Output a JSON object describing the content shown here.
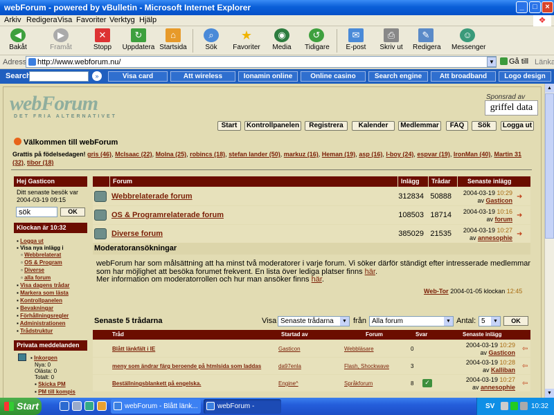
{
  "window": {
    "title": "webForum - powered by vBulletin - Microsoft Internet Explorer"
  },
  "menu": [
    "Arkiv",
    "Redigera",
    "Visa",
    "Favoriter",
    "Verktyg",
    "Hjälp"
  ],
  "toolbar": [
    {
      "label": "Bakåt",
      "icon": "back-icon"
    },
    {
      "label": "Framåt",
      "icon": "forward-icon"
    },
    {
      "label": "Stopp",
      "icon": "stop-icon"
    },
    {
      "label": "Uppdatera",
      "icon": "refresh-icon"
    },
    {
      "label": "Startsida",
      "icon": "home-icon"
    },
    {
      "label": "Sök",
      "icon": "search-icon"
    },
    {
      "label": "Favoriter",
      "icon": "star-icon"
    },
    {
      "label": "Media",
      "icon": "media-icon"
    },
    {
      "label": "Tidigare",
      "icon": "history-icon"
    },
    {
      "label": "E-post",
      "icon": "mail-icon"
    },
    {
      "label": "Skriv ut",
      "icon": "print-icon"
    },
    {
      "label": "Redigera",
      "icon": "edit-icon"
    },
    {
      "label": "Messenger",
      "icon": "messenger-icon"
    }
  ],
  "address": {
    "label": "Adress",
    "url": "http://www.webforum.nu/",
    "go": "Gå till",
    "links": "Länkar"
  },
  "search_toolbar": {
    "label": "Search",
    "links": [
      "Visa card",
      "Att wireless",
      "Ionamin online",
      "Online casino",
      "Search engine",
      "Att broadband",
      "Logo design"
    ]
  },
  "site": {
    "logo": "webForum",
    "tagline": "DET FRIA ALTERNATIVET",
    "sponsor_label": "Sponsrad av",
    "sponsor": "griffel data",
    "nav": [
      "Start",
      "Kontrollpanelen",
      "Registrera",
      "Kalender",
      "Medlemmar",
      "FAQ",
      "Sök",
      "Logga ut"
    ],
    "welcome": "Välkommen till webForum",
    "birthday_label": "Grattis på födelsedagen!",
    "birthdays": [
      "gris (46)",
      "McIsaac (22)",
      "Molna (25)",
      "robincs (18)",
      "stefan lander (50)",
      "markuz (16)",
      "Heman (19)",
      "asp (16)",
      "l-boy (24)",
      "espvar (19)",
      "IronMan (40)",
      "Martin 31 (32)",
      "tibor (18)"
    ]
  },
  "sidebar": {
    "greeting": "Hej Gasticon",
    "last_visit": "Ditt senaste besök var 2004-03-19 09:15",
    "search_value": "sök",
    "ok": "OK",
    "clock_head": "Klockan är 10:32",
    "links": [
      {
        "text": "Logga ut",
        "level": 0,
        "bold": false
      },
      {
        "text": "Visa nya inlägg i",
        "level": 0,
        "bold": true
      },
      {
        "text": "Webbrelaterat",
        "level": 1,
        "bold": false
      },
      {
        "text": "OS & Program",
        "level": 1,
        "bold": false
      },
      {
        "text": "Diverse",
        "level": 1,
        "bold": false
      },
      {
        "text": "alla forum",
        "level": 1,
        "bold": false
      },
      {
        "text": "Visa dagens trådar",
        "level": 0,
        "bold": false
      },
      {
        "text": "Markera som lästa",
        "level": 0,
        "bold": false
      },
      {
        "text": "Kontrollpanelen",
        "level": 0,
        "bold": false
      },
      {
        "text": "Bevakningar",
        "level": 0,
        "bold": false
      },
      {
        "text": "Förhållningsregler",
        "level": 0,
        "bold": false
      },
      {
        "text": "Administrationen",
        "level": 0,
        "bold": false
      },
      {
        "text": "Trådstruktur",
        "level": 0,
        "bold": false
      }
    ],
    "pm_head": "Privata meddelanden",
    "pm": {
      "inbox": "Inkorgen",
      "new": "Nya: 0",
      "unread": "Olästa: 0",
      "total": "Totalt: 0",
      "send": "Skicka PM",
      "to_friend": "PM till kompis"
    }
  },
  "forums": {
    "headers": [
      "Forum",
      "Inlägg",
      "Trådar",
      "Senaste inlägg"
    ],
    "rows": [
      {
        "name": "Webbrelaterade forum",
        "posts": "312834",
        "threads": "50888",
        "date": "2004-03-19",
        "time": "10:29",
        "by": "av",
        "user": "Gasticon"
      },
      {
        "name": "OS & Programrelaterade forum",
        "posts": "108503",
        "threads": "18714",
        "date": "2004-03-19",
        "time": "10:16",
        "by": "av",
        "user": "forum"
      },
      {
        "name": "Diverse forum",
        "posts": "385029",
        "threads": "21535",
        "date": "2004-03-19",
        "time": "10:27",
        "by": "av",
        "user": "annesophie"
      }
    ]
  },
  "moderator": {
    "title": "Moderatoransökningar",
    "p1": "webForum har som målsättning att ha minst två moderatorer i varje forum. Vi söker därför ständigt efter intresserade medlemmar som har möjlighet att besöka forumet frekvent. En lista över lediga platser finns ",
    "link1": "här",
    "p1_end": ".",
    "p2": "Mer information om moderatorrollen och hur man ansöker finns ",
    "link2": "här",
    "p2_end": ".",
    "sig_user": "Web-Tor",
    "sig_date": "2004-01-05 klockan",
    "sig_time": "12:45"
  },
  "latest": {
    "title": "Senaste 5 trådarna",
    "visa": "Visa",
    "visa_value": "Senaste trådarna",
    "fran": "från",
    "fran_value": "Alla forum",
    "antal": "Antal:",
    "antal_value": "5",
    "ok": "OK",
    "headers": [
      "Tråd",
      "Startad av",
      "Forum",
      "Svar",
      "Senaste inlägg"
    ],
    "rows": [
      {
        "thread": "Blått länkfält i IE",
        "starter": "Gasticon",
        "forum": "Webbläsare",
        "replies": "0",
        "date": "2004-03-19",
        "time": "10:29",
        "by": "av",
        "user": "Gasticon"
      },
      {
        "thread": "meny som ändrar färg beroende på htmlsida som laddas",
        "starter": "da97enla",
        "forum": "Flash, Shockwave",
        "replies": "3",
        "date": "2004-03-19",
        "time": "10:28",
        "by": "av",
        "user": "Kalliban"
      },
      {
        "thread": "Beställningsblankett på engelska.",
        "starter": "Engine^",
        "forum": "Språkforum",
        "replies": "8",
        "date": "2004-03-19",
        "time": "10:27",
        "by": "av",
        "user": "annesophie"
      }
    ]
  },
  "taskbar": {
    "start": "Start",
    "tasks": [
      "webForum - Blått länk...",
      "webForum - powered..."
    ],
    "lang": "SV",
    "clock": "10:32"
  },
  "colors": {
    "header": "#6b0d00",
    "link": "#7a1e06",
    "page_bg": "#e2dcb3",
    "xp_blue": "#245edb"
  }
}
